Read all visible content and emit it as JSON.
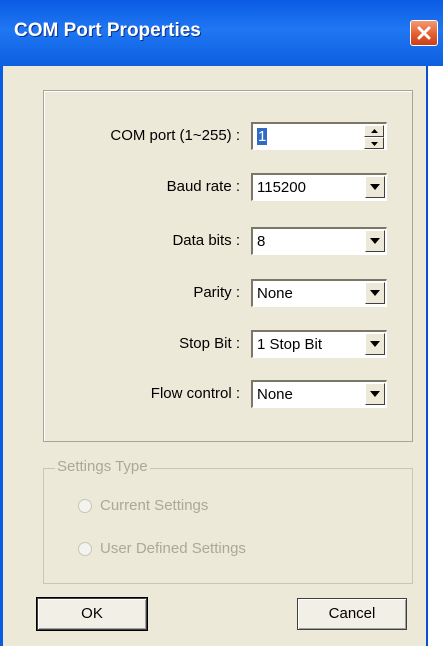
{
  "window": {
    "title": "COM Port Properties"
  },
  "form": {
    "com_port": {
      "label": "COM port (1~255) :",
      "value": "1"
    },
    "baud_rate": {
      "label": "Baud rate :",
      "value": "115200"
    },
    "data_bits": {
      "label": "Data bits :",
      "value": "8"
    },
    "parity": {
      "label": "Parity :",
      "value": "None"
    },
    "stop_bit": {
      "label": "Stop Bit :",
      "value": "1 Stop Bit"
    },
    "flow_control": {
      "label": "Flow control :",
      "value": "None"
    }
  },
  "settings_type": {
    "legend": "Settings Type",
    "options": [
      {
        "label": "Current Settings",
        "selected": false,
        "enabled": false
      },
      {
        "label": "User Defined Settings",
        "selected": false,
        "enabled": false
      }
    ]
  },
  "buttons": {
    "ok": "OK",
    "cancel": "Cancel"
  },
  "icons": {
    "close": "close-icon",
    "dropdown": "chevron-down-icon",
    "spin_up": "arrow-up-icon",
    "spin_down": "arrow-down-icon"
  },
  "colors": {
    "titlebar": "#0a5be3",
    "dialog_bg": "#ece9d8",
    "disabled_text": "#aca899",
    "close_button": "#e05a2c"
  }
}
